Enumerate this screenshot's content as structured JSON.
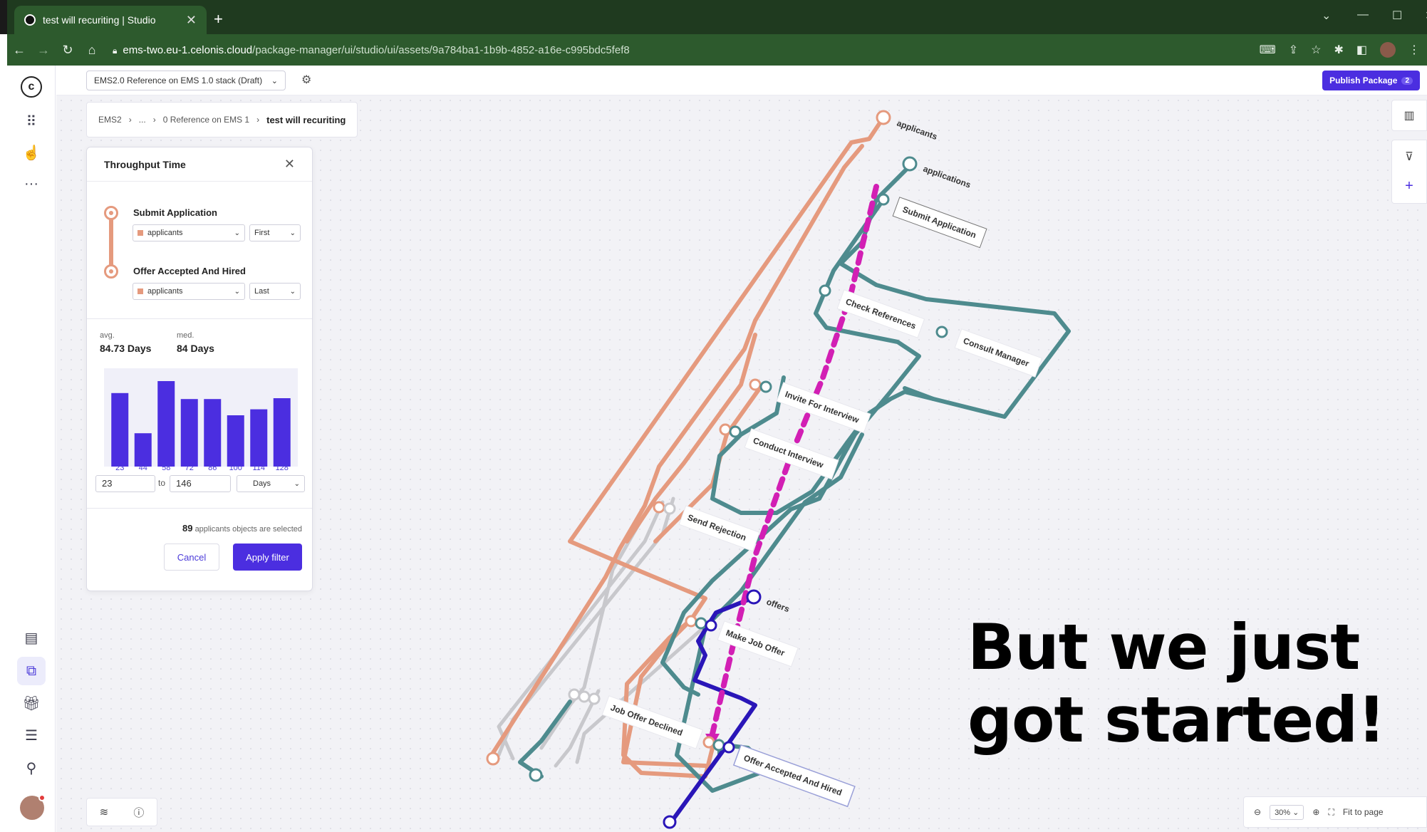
{
  "browser": {
    "tab_title": "test will recuriting | Studio",
    "url_host": "ems-two.eu-1.celonis.cloud",
    "url_path": "/package-manager/ui/studio/ui/assets/9a784ba1-1b9b-4852-a16e-c995bdc5fef8"
  },
  "topbar": {
    "package": "EMS2.0 Reference on EMS 1.0 stack (Draft)",
    "publish_label": "Publish Package",
    "publish_count": "2"
  },
  "breadcrumb": [
    "EMS2",
    "...",
    "0 Reference on EMS 1",
    "test will recuriting"
  ],
  "panel": {
    "title": "Throughput Time",
    "start": {
      "activity": "Submit Application",
      "object": "applicants",
      "mode": "First"
    },
    "end": {
      "activity": "Offer Accepted And Hired",
      "object": "applicants",
      "mode": "Last"
    },
    "avg_caption": "avg.",
    "avg_value": "84.73 Days",
    "med_caption": "med.",
    "med_value": "84 Days",
    "range_from": "23",
    "range_to_label": "to",
    "range_to": "146",
    "unit": "Days",
    "selected_count": "89",
    "selected_text": "applicants objects are selected",
    "cancel": "Cancel",
    "apply": "Apply filter"
  },
  "chart_data": {
    "type": "bar",
    "categories": [
      "23",
      "44",
      "58",
      "72",
      "86",
      "100",
      "114",
      "128"
    ],
    "values": [
      0.86,
      0.39,
      1.0,
      0.79,
      0.79,
      0.6,
      0.67,
      0.8
    ],
    "ylim": [
      0,
      1
    ]
  },
  "graph_labels": {
    "object_applicants": "applicants",
    "object_applications": "applications",
    "object_offers": "offers",
    "submit_application": "Submit Application",
    "check_references": "Check References",
    "consult_manager": "Consult Manager",
    "invite_for_interview": "Invite For Interview",
    "conduct_interview": "Conduct Interview",
    "send_rejection": "Send Rejection",
    "make_job_offer": "Make Job Offer",
    "job_offer_declined": "Job Offer Declined",
    "offer_accepted_and_hired": "Offer Accepted And Hired"
  },
  "zoom": {
    "level": "30%",
    "fit_label": "Fit to page"
  },
  "overlay": {
    "line1": "But we just",
    "line2": "got started!"
  },
  "colors": {
    "accent": "#4b2ee0",
    "applicants": "#e59a7e",
    "applications": "#4e8b8e",
    "offers": "#2a16b8",
    "highlight": "#d21fb4"
  }
}
